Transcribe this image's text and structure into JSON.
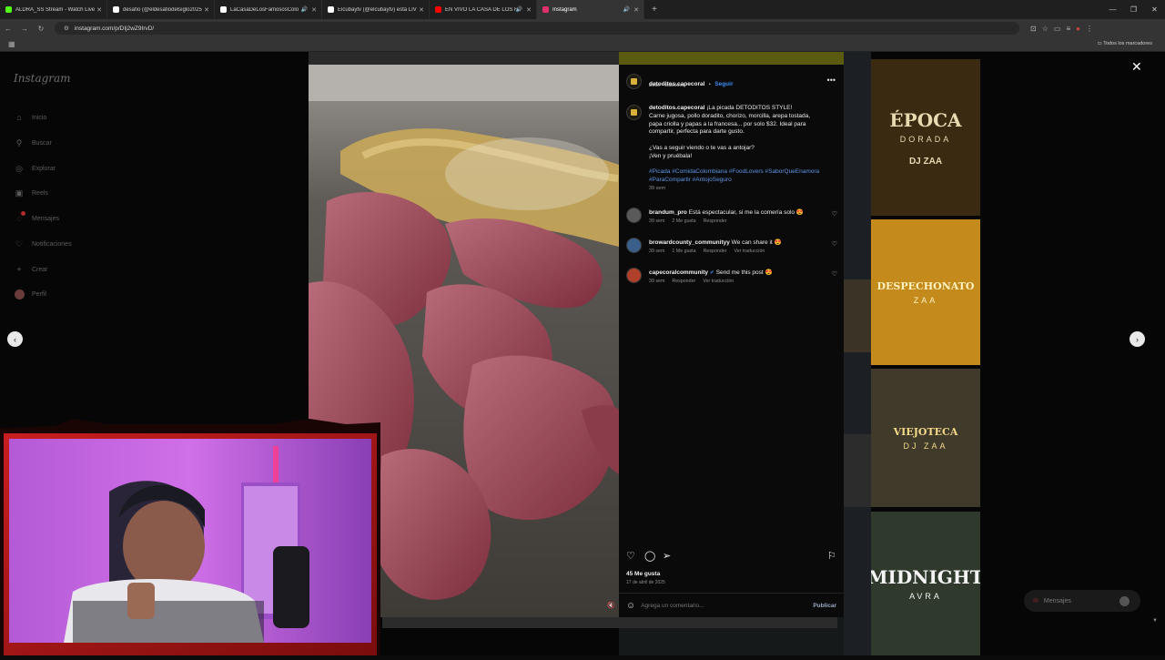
{
  "browser": {
    "tabs": [
      {
        "label": "ALDRA_SS Stream - Watch Live",
        "color": "#53fc18",
        "active": false,
        "audio": false
      },
      {
        "label": "desafio (@eldesafiodelsiglo2025",
        "color": "#ffffff",
        "active": false,
        "audio": false
      },
      {
        "label": "LaCasaDeLosFamososColo",
        "color": "#ffffff",
        "active": false,
        "audio": true
      },
      {
        "label": "Elcubaytv (@elcubaytv) está LIV",
        "color": "#ffffff",
        "active": false,
        "audio": false
      },
      {
        "label": "EN VIVO LA CASA DE LOS F",
        "color": "#ff0000",
        "active": false,
        "audio": true
      },
      {
        "label": "Instagram",
        "color": "#e1306c",
        "active": true,
        "audio": true
      }
    ],
    "url": "instagram.com/p/DIj2wZ9IrvD/",
    "bookmarks_label": "Todos los marcadores"
  },
  "sidebar": {
    "logo": "Instagram",
    "items": [
      {
        "label": "Inicio",
        "icon": "home-icon",
        "glyph": "⌂"
      },
      {
        "label": "Buscar",
        "icon": "search-icon",
        "glyph": "⚲"
      },
      {
        "label": "Explorar",
        "icon": "compass-icon",
        "glyph": "◎"
      },
      {
        "label": "Reels",
        "icon": "reels-icon",
        "glyph": "▣"
      },
      {
        "label": "Mensajes",
        "icon": "messenger-icon",
        "glyph": "◌"
      },
      {
        "label": "Notificaciones",
        "icon": "heart-icon",
        "glyph": "♡"
      },
      {
        "label": "Crear",
        "icon": "plus-icon",
        "glyph": "+"
      },
      {
        "label": "Perfil",
        "icon": "profile-avatar-icon",
        "glyph": ""
      }
    ]
  },
  "post": {
    "username": "detoditos.capecoral",
    "follow_label": "Seguir",
    "separator": "•",
    "audio_artist": "Belle",
    "audio_track": "sobelove",
    "caption_user": "detoditos.capecoral",
    "caption_lines": [
      "¡La picada DETODITOS STYLE!",
      "Carne jugosa, pollo doradito, chorizo, morcilla, arepa tostada,",
      "papa criolla y papas a la francesa... por solo $32. Ideal para",
      "compartir, perfecta para darte gusto.",
      "",
      "¿Vas a seguir viendo o te vas a antojar?",
      "¡Ven y pruébala!"
    ],
    "hashtags_line1": "#Picada #ComidaColombiana #FoodLovers #SaborQueEnamora",
    "hashtags_line2": "#ParaCompartir #AntojoSeguro",
    "caption_time": "39 sem",
    "comments": [
      {
        "user": "brandum_pro",
        "text": "Está espectacular, si me la comería solo 😍",
        "time": "39 sem",
        "likes": "2 Me gusta",
        "reply": "Responder",
        "translate": "",
        "verified": false
      },
      {
        "user": "browardcounty_communityy",
        "text": "We can share it 😍",
        "time": "39 sem",
        "likes": "1 Me gusta",
        "reply": "Responder",
        "translate": "Ver traducción",
        "verified": false
      },
      {
        "user": "capecoralcommunity",
        "text": "Send me this post 😍",
        "time": "39 sem",
        "likes": "",
        "reply": "Responder",
        "translate": "Ver traducción",
        "verified": true
      }
    ],
    "likes_count": "45 Me gusta",
    "date": "17 de abril de 2025",
    "comment_placeholder": "Agrega un comentario...",
    "publish_label": "Publicar"
  },
  "background_posters": [
    {
      "title": "ÉPOCA",
      "subtitle": "DORADA",
      "footer": "DJ ZAA",
      "bg": "#3a2a12",
      "fg": "#e8d9b0"
    },
    {
      "title": "DESPECHONATO",
      "subtitle": "ZAA",
      "footer": "",
      "bg": "#c58a1c",
      "fg": "#fff3c0"
    },
    {
      "title": "VIEJOTECA",
      "subtitle": "DJ ZAA",
      "footer": "",
      "bg": "#3f3a2a",
      "fg": "#f5d98a"
    },
    {
      "title": "MIDNIGHT",
      "subtitle": "AVRA",
      "footer": "",
      "bg": "#2f3a2d",
      "fg": "#f4f4f4"
    }
  ],
  "messages_label": "Mensajes"
}
